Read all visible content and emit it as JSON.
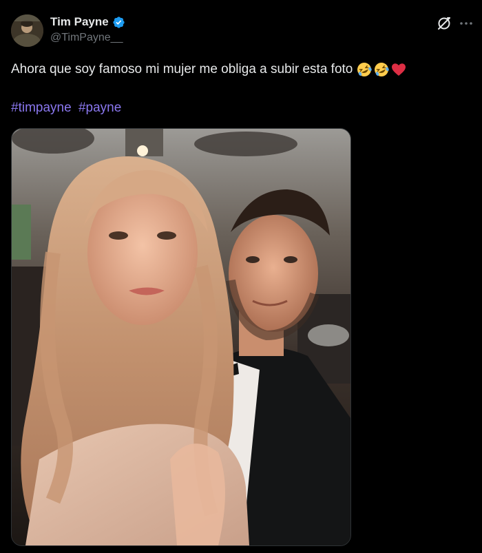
{
  "author": {
    "display_name": "Tim Payne",
    "handle": "@TimPayne__",
    "verified": true
  },
  "post": {
    "text": "Ahora que soy famoso mi mujer me obliga a subir esta foto",
    "emojis": [
      "rolling-on-floor-laughing-emoji",
      "rolling-on-floor-laughing-emoji",
      "red-heart-emoji"
    ],
    "hashtags": [
      "#timpayne",
      "#payne"
    ]
  },
  "icons": {
    "grok": "grok-icon",
    "more": "more-options-icon",
    "verified": "verified-badge-icon"
  },
  "colors": {
    "background": "#000000",
    "text": "#e7e9ea",
    "secondary_text": "#71767b",
    "hashtag": "#8b78f0",
    "verified_badge": "#1d9bf0"
  }
}
